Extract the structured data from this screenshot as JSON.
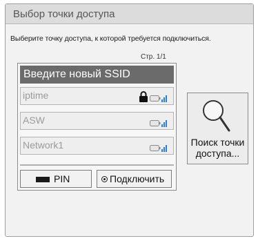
{
  "dialog": {
    "title": "Выбор точки доступа",
    "subtitle": "Выберите точку доступа, к которой требуется подключиться.",
    "page_indicator": "Стр. 1/1"
  },
  "list": {
    "new_ssid_label": "Введите новый SSID",
    "networks": [
      {
        "name": "iptime",
        "secured": true,
        "icon": "wifi-signal-icon"
      },
      {
        "name": "ASW",
        "secured": false,
        "icon": "wifi-signal-icon"
      },
      {
        "name": "Network1",
        "secured": false,
        "icon": "wifi-signal-icon"
      }
    ]
  },
  "buttons": {
    "pin_label": "PIN",
    "connect_label": "Подключить",
    "search_line1": "Поиск точки",
    "search_line2": "доступа..."
  },
  "colors": {
    "selected_bg": "#6b6b6b",
    "signal_bars": "#2c7fd6",
    "dimmed_text": "#9a9a9a"
  }
}
